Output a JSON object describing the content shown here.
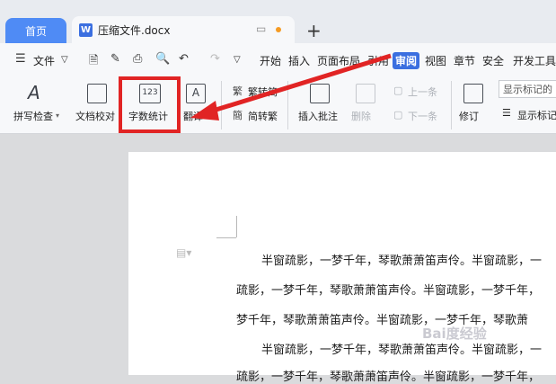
{
  "tabs": {
    "home": "首页",
    "doc_title": "压缩文件.docx",
    "plus": "+"
  },
  "menu": {
    "file": "文件",
    "items": [
      "开始",
      "插入",
      "页面布局",
      "引用",
      "审阅",
      "视图",
      "章节",
      "安全",
      "开发工具"
    ],
    "active": "审阅"
  },
  "ribbon": {
    "spell": "拼写检查",
    "proofread": "文档校对",
    "word_count": "字数统计",
    "word_count_icon_text": "123",
    "translate": "翻译",
    "t2s": "繁转简",
    "s2t": "简转繁",
    "insert_comment": "插入批注",
    "delete": "删除",
    "prev": "上一条",
    "next": "下一条",
    "revise": "修订",
    "show_markup": "显示标记的",
    "show_markup2": "显示标记"
  },
  "document": {
    "lines": [
      "半窗疏影，一梦千年，琴歌萧萧笛声伶。半窗疏影，一",
      "疏影，一梦千年，琴歌萧萧笛声伶。半窗疏影，一梦千年，",
      "梦千年，琴歌萧萧笛声伶。半窗疏影，一梦千年，琴歌萧",
      "半窗疏影，一梦千年，琴歌萧萧笛声伶。半窗疏影，一",
      "疏影，一梦千年，琴歌萧萧笛声伶。半窗疏影，一梦千年，"
    ],
    "watermark": "Bai度经验"
  },
  "colors": {
    "accent": "#3b6fe0",
    "highlight_box": "#e12424",
    "arrow": "#e12424"
  }
}
